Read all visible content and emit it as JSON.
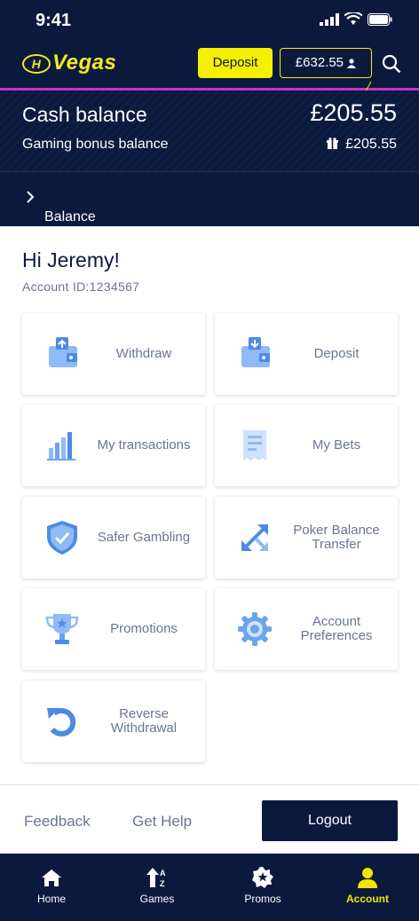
{
  "status": {
    "time": "9:41"
  },
  "header": {
    "logo_text": "Vegas",
    "logo_mark": "H",
    "deposit_label": "Deposit",
    "balance_label": "£632.55"
  },
  "balance": {
    "cash_label": "Cash balance",
    "cash_value": "£205.55",
    "bonus_label": "Gaming bonus balance",
    "bonus_value": "£205.55",
    "info_label": "Balance information"
  },
  "greeting": {
    "hello": "Hi Jeremy!",
    "account_id": "Account ID:1234567"
  },
  "tiles": [
    {
      "label": "Withdraw",
      "icon": "wallet-up-icon"
    },
    {
      "label": "Deposit",
      "icon": "wallet-down-icon"
    },
    {
      "label": "My transactions",
      "icon": "bar-chart-icon"
    },
    {
      "label": "My Bets",
      "icon": "receipt-icon"
    },
    {
      "label": "Safer Gambling",
      "icon": "shield-check-icon"
    },
    {
      "label": "Poker Balance Transfer",
      "icon": "transfer-arrows-icon"
    },
    {
      "label": "Promotions",
      "icon": "trophy-icon"
    },
    {
      "label": "Account Preferences",
      "icon": "gear-icon"
    },
    {
      "label": "Reverse Withdrawal",
      "icon": "reverse-icon"
    }
  ],
  "footer": {
    "feedback": "Feedback",
    "help": "Get Help",
    "logout": "Logout"
  },
  "tabs": [
    {
      "label": "Home",
      "icon": "home-icon"
    },
    {
      "label": "Games",
      "icon": "games-sort-icon"
    },
    {
      "label": "Promos",
      "icon": "promos-badge-icon"
    },
    {
      "label": "Account",
      "icon": "account-icon"
    }
  ],
  "colors": {
    "navy": "#0b1a3c",
    "accent_yellow": "#f5f000",
    "tile_icon_blue": "#6aa3ef",
    "divider_pink": "#c334c9"
  }
}
